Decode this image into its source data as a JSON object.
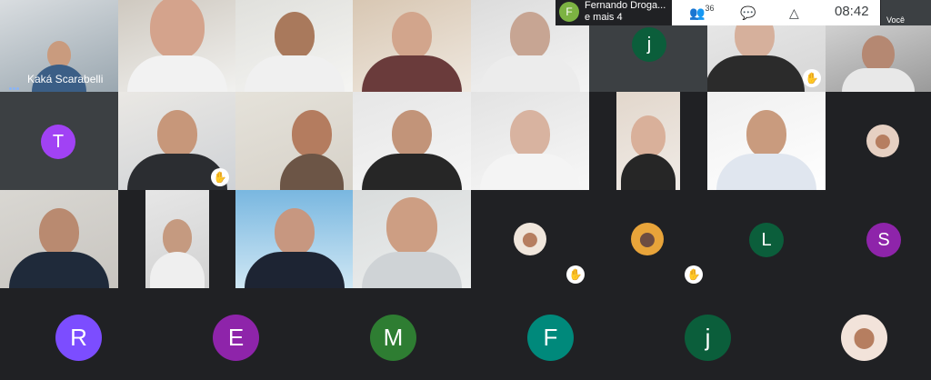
{
  "presentation": {
    "presenter_initial": "F",
    "title_line1": "Fernando Droga...",
    "title_line2": "e mais 4"
  },
  "toolbar": {
    "participants_count": "36",
    "time": "08:42",
    "self_label": "Você"
  },
  "speaker": {
    "name": "Kaká Scarabelli"
  },
  "colors": {
    "purple": "#a142f4",
    "green": "#0b5e3b",
    "violet": "#8e24aa",
    "olive": "#2e7d32",
    "teal": "#00897b",
    "indigo": "#7c4dff"
  },
  "avatars": {
    "t": "T",
    "j1": "j",
    "l": "L",
    "s": "S",
    "r": "R",
    "e": "E",
    "m": "M",
    "f": "F",
    "j2": "j"
  }
}
